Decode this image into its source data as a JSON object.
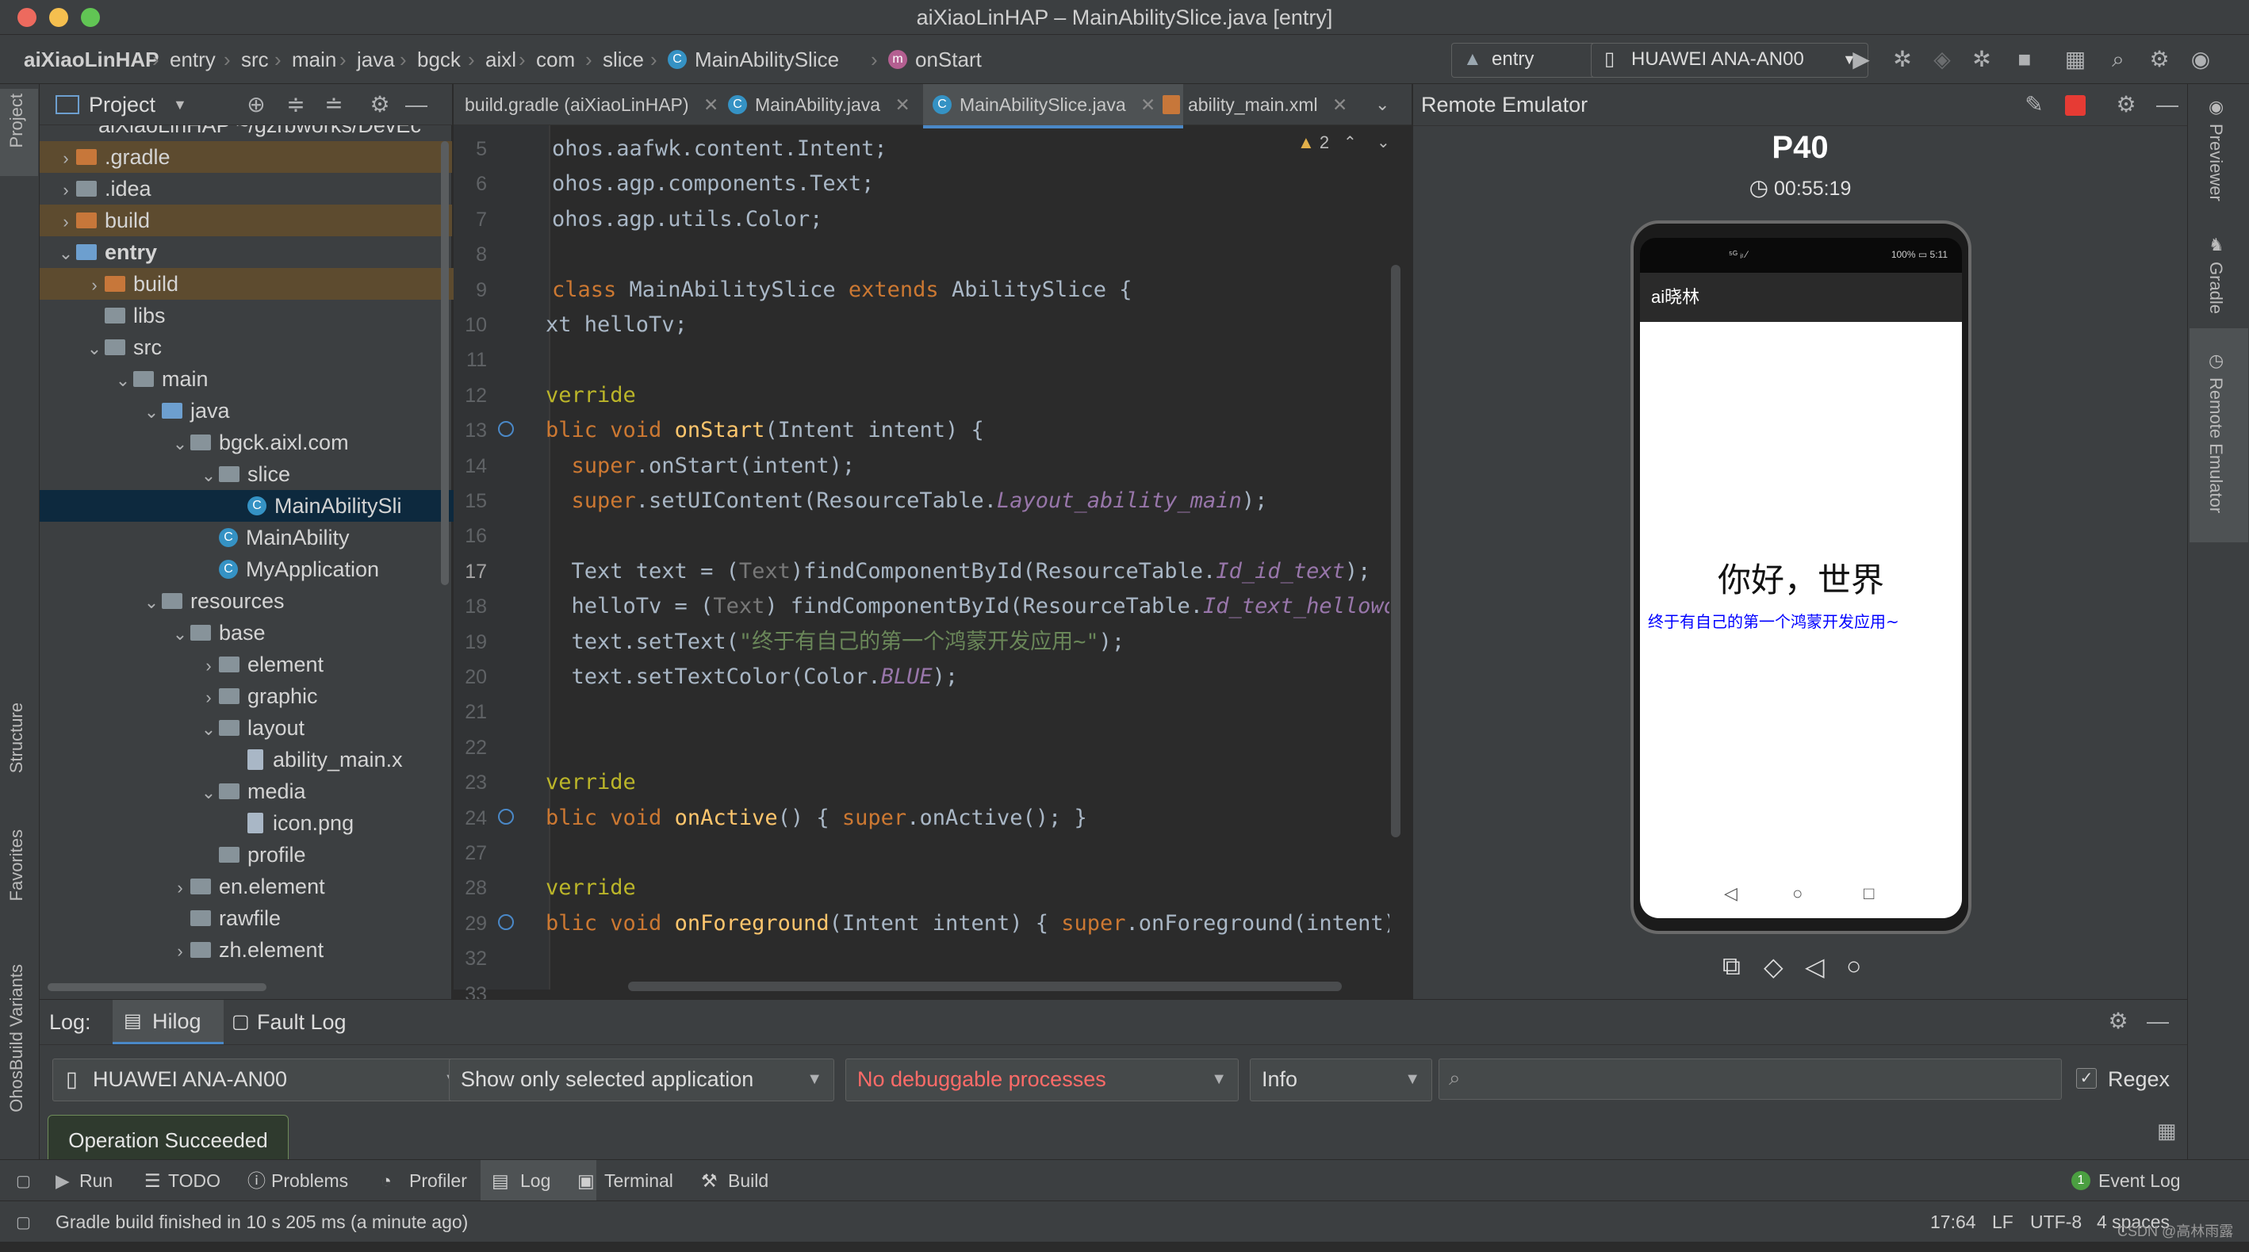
{
  "window": {
    "title": "aiXiaoLinHAP – MainAbilitySlice.java [entry]"
  },
  "breadcrumbs": [
    "aiXiaoLinHAP",
    "entry",
    "src",
    "main",
    "java",
    "bgck",
    "aixl",
    "com",
    "slice",
    "MainAbilitySlice",
    "onStart"
  ],
  "toolbar": {
    "run_config": "entry",
    "device": "HUAWEI ANA-AN00"
  },
  "left_stripe": {
    "project": "Project",
    "structure": "Structure",
    "favorites": "Favorites",
    "ohos_build": "OhosBuild Variants"
  },
  "project_panel": {
    "view_label": "Project",
    "root_label": "aiXiaoLinHAP ~/gzrbworks/DevEc",
    "tree": [
      {
        "label": ".gradle",
        "depth": 1,
        "arrow": "›",
        "icon": "folder-orange",
        "excluded": true
      },
      {
        "label": ".idea",
        "depth": 1,
        "arrow": "›",
        "icon": "folder"
      },
      {
        "label": "build",
        "depth": 1,
        "arrow": "›",
        "icon": "folder-orange",
        "excluded": true
      },
      {
        "label": "entry",
        "depth": 1,
        "arrow": "⌄",
        "icon": "folder-blue",
        "bold": true
      },
      {
        "label": "build",
        "depth": 2,
        "arrow": "›",
        "icon": "folder-orange",
        "excluded": true
      },
      {
        "label": "libs",
        "depth": 2,
        "arrow": "",
        "icon": "folder"
      },
      {
        "label": "src",
        "depth": 2,
        "arrow": "⌄",
        "icon": "folder"
      },
      {
        "label": "main",
        "depth": 3,
        "arrow": "⌄",
        "icon": "folder"
      },
      {
        "label": "java",
        "depth": 4,
        "arrow": "⌄",
        "icon": "folder-blue"
      },
      {
        "label": "bgck.aixl.com",
        "depth": 5,
        "arrow": "⌄",
        "icon": "folder"
      },
      {
        "label": "slice",
        "depth": 6,
        "arrow": "⌄",
        "icon": "folder"
      },
      {
        "label": "MainAbilitySli",
        "depth": 7,
        "arrow": "",
        "icon": "class",
        "selected": true
      },
      {
        "label": "MainAbility",
        "depth": 6,
        "arrow": "",
        "icon": "class"
      },
      {
        "label": "MyApplication",
        "depth": 6,
        "arrow": "",
        "icon": "class"
      },
      {
        "label": "resources",
        "depth": 4,
        "arrow": "⌄",
        "icon": "folder"
      },
      {
        "label": "base",
        "depth": 5,
        "arrow": "⌄",
        "icon": "folder"
      },
      {
        "label": "element",
        "depth": 6,
        "arrow": "›",
        "icon": "folder"
      },
      {
        "label": "graphic",
        "depth": 6,
        "arrow": "›",
        "icon": "folder"
      },
      {
        "label": "layout",
        "depth": 6,
        "arrow": "⌄",
        "icon": "folder"
      },
      {
        "label": "ability_main.x",
        "depth": 7,
        "arrow": "",
        "icon": "file"
      },
      {
        "label": "media",
        "depth": 6,
        "arrow": "⌄",
        "icon": "folder"
      },
      {
        "label": "icon.png",
        "depth": 7,
        "arrow": "",
        "icon": "file"
      },
      {
        "label": "profile",
        "depth": 6,
        "arrow": "",
        "icon": "folder"
      },
      {
        "label": "en.element",
        "depth": 5,
        "arrow": "›",
        "icon": "folder"
      },
      {
        "label": "rawfile",
        "depth": 5,
        "arrow": "",
        "icon": "folder"
      },
      {
        "label": "zh.element",
        "depth": 5,
        "arrow": "›",
        "icon": "folder"
      }
    ]
  },
  "editor": {
    "tabs": [
      {
        "label": "build.gradle (aiXiaoLinHAP)",
        "active": false
      },
      {
        "label": "MainAbility.java",
        "active": false
      },
      {
        "label": "MainAbilitySlice.java",
        "active": true
      },
      {
        "label": "ability_main.xml",
        "active": false
      }
    ],
    "warnings": "2",
    "lines": [
      {
        "n": "5",
        "html": "<span>ohos.aafwk.content.Intent;</span>"
      },
      {
        "n": "6",
        "html": "<span>ohos.agp.components.Text;</span>"
      },
      {
        "n": "7",
        "html": "<span>ohos.agp.utils.Color;</span>"
      },
      {
        "n": "8",
        "html": ""
      },
      {
        "n": "9",
        "html": "<span class='kw'>class</span> MainAbilitySlice <span class='kw'>extends</span> AbilitySlice {"
      },
      {
        "n": "10",
        "html": "xt helloTv;"
      },
      {
        "n": "11",
        "html": ""
      },
      {
        "n": "12",
        "html": "<span class='ann'>verride</span>"
      },
      {
        "n": "13",
        "html": "<span class='kw'>blic void</span> <span class='fn'>onStart</span>(Intent intent) {"
      },
      {
        "n": "14",
        "html": "  <span class='kw'>super</span>.onStart(intent);"
      },
      {
        "n": "15",
        "html": "  <span class='kw'>super</span>.setUIContent(ResourceTable.<span class='it'>Layout_ability_main</span>);"
      },
      {
        "n": "16",
        "html": ""
      },
      {
        "n": "17",
        "html": "  Text text = (<span class='hint'>Text</span>)findComponentById(ResourceTable.<span class='it'>Id_id_text</span>);"
      },
      {
        "n": "18",
        "html": "  helloTv = (<span class='hint'>Text</span>) findComponentById(ResourceTable.<span class='it'>Id_text_helloworl</span>"
      },
      {
        "n": "19",
        "html": "  text.setText(<span class='str'>\"终于有自己的第一个鸿蒙开发应用~\"</span>);"
      },
      {
        "n": "20",
        "html": "  text.setTextColor(Color.<span class='cst'>BLUE</span>);"
      },
      {
        "n": "21",
        "html": ""
      },
      {
        "n": "22",
        "html": ""
      },
      {
        "n": "23",
        "html": "<span class='ann'>verride</span>"
      },
      {
        "n": "24",
        "html": "<span class='kw'>blic void</span> <span class='fn'>onActive</span>() { <span class='kw'>super</span>.onActive(); }"
      },
      {
        "n": "27",
        "html": ""
      },
      {
        "n": "28",
        "html": "<span class='ann'>verride</span>"
      },
      {
        "n": "29",
        "html": "<span class='kw'>blic void</span> <span class='fn'>onForeground</span>(Intent intent) { <span class='kw'>super</span>.onForeground(intent);"
      },
      {
        "n": "32",
        "html": ""
      },
      {
        "n": "33",
        "html": ""
      }
    ]
  },
  "emulator": {
    "panel_title": "Remote Emulator",
    "device_name": "P40",
    "timer": "00:55:19",
    "status_left": "⁵ᴳ ᵢₗ ⁄",
    "status_right": "100% ▭ 5:11",
    "app_title": "ai晓林",
    "hello_text": "你好，世界",
    "app_text": "终于有自己的第一个鸿蒙开发应用~"
  },
  "right_stripe": {
    "previewer": "Previewer",
    "gradle": "Gradle",
    "remote_emulator": "Remote Emulator"
  },
  "log": {
    "label": "Log:",
    "tabs": [
      "Hilog",
      "Fault Log"
    ],
    "device": "HUAWEI ANA-AN00",
    "filter": "Show only selected application",
    "process": "No debuggable processes",
    "level": "Info",
    "search_placeholder": "",
    "regex_label": "Regex",
    "tooltip": "Operation Succeeded"
  },
  "bottom_tools": [
    "Run",
    "TODO",
    "Problems",
    "Profiler",
    "Log",
    "Terminal",
    "Build"
  ],
  "event_log": {
    "count": "1",
    "label": "Event Log"
  },
  "status": {
    "message": "Gradle build finished in 10 s 205 ms (a minute ago)",
    "position": "17:64",
    "line_sep": "LF",
    "encoding": "UTF-8",
    "indent": "4 spaces",
    "watermark": "CSDN @高林雨露"
  },
  "colors": {
    "accent": "#4a88c7",
    "error_text": "#ff6b68",
    "app_text_blue": "#0000ff"
  }
}
